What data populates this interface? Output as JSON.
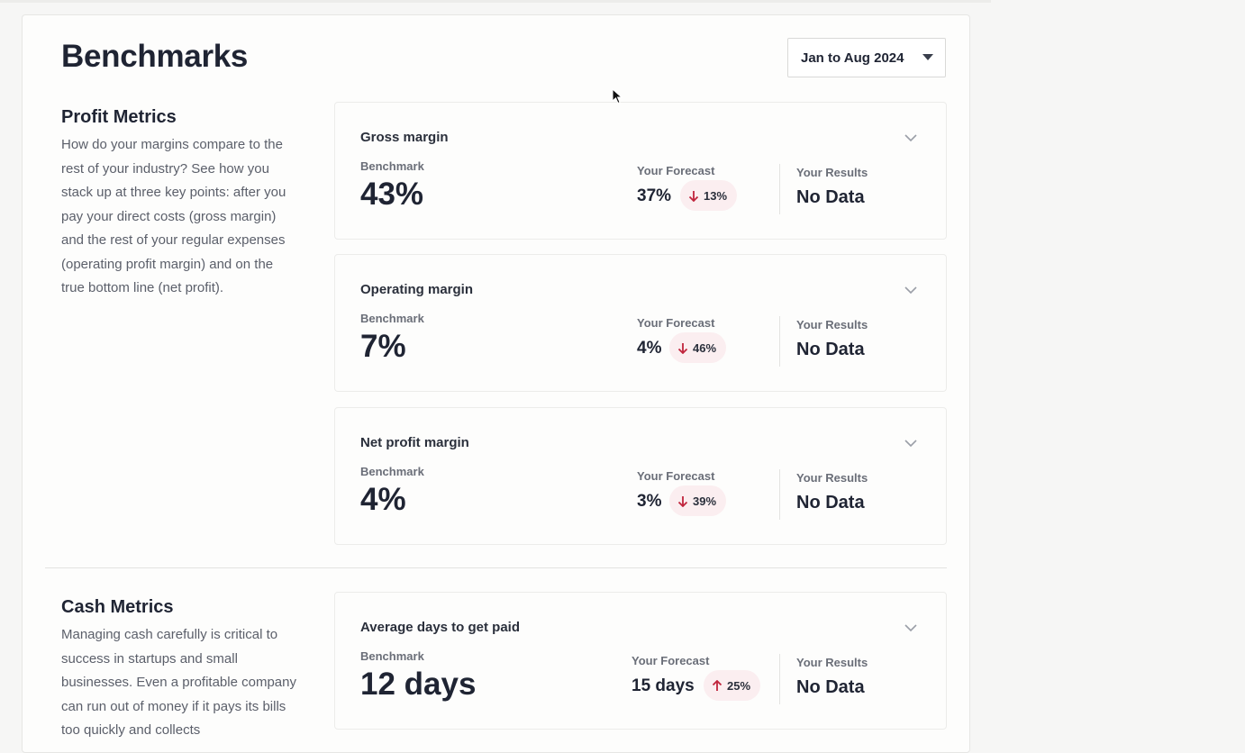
{
  "page": {
    "title": "Benchmarks",
    "date_range": "Jan to Aug 2024"
  },
  "sections": [
    {
      "title": "Profit Metrics",
      "description": "How do your margins compare to the rest of your industry? See how you stack up at three key points: after you pay your direct costs (gross margin) and the rest of your regular expenses (operating profit margin) and on the true bottom line (net profit)."
    },
    {
      "title": "Cash Metrics",
      "description": "Managing cash carefully is critical to success in startups and small businesses. Even a profitable company can run out of money if it pays its bills too quickly and collects"
    }
  ],
  "cards": [
    {
      "title": "Gross margin",
      "benchmark_label": "Benchmark",
      "benchmark_value": "43%",
      "forecast_label": "Your Forecast",
      "forecast_value": "37%",
      "change": "13%",
      "change_direction": "down",
      "results_label": "Your Results",
      "results_value": "No Data"
    },
    {
      "title": "Operating margin",
      "benchmark_label": "Benchmark",
      "benchmark_value": "7%",
      "forecast_label": "Your Forecast",
      "forecast_value": "4%",
      "change": "46%",
      "change_direction": "down",
      "results_label": "Your Results",
      "results_value": "No Data"
    },
    {
      "title": "Net profit margin",
      "benchmark_label": "Benchmark",
      "benchmark_value": "4%",
      "forecast_label": "Your Forecast",
      "forecast_value": "3%",
      "change": "39%",
      "change_direction": "down",
      "results_label": "Your Results",
      "results_value": "No Data"
    },
    {
      "title": "Average days to get paid",
      "benchmark_label": "Benchmark",
      "benchmark_value": "12 days",
      "forecast_label": "Your Forecast",
      "forecast_value": "15 days",
      "change": "25%",
      "change_direction": "up",
      "results_label": "Your Results",
      "results_value": "No Data"
    }
  ],
  "colors": {
    "change_arrow": "#c0243c",
    "badge_background": "#fbeef0",
    "text_primary": "#1f2433",
    "text_secondary": "#5b5f6a"
  },
  "icons": {
    "date_select": "caret-down-icon",
    "card_toggle": "chevron-down-icon",
    "change_down": "arrow-down-icon",
    "change_up": "arrow-up-icon",
    "pointer": "mouse-cursor-icon"
  }
}
